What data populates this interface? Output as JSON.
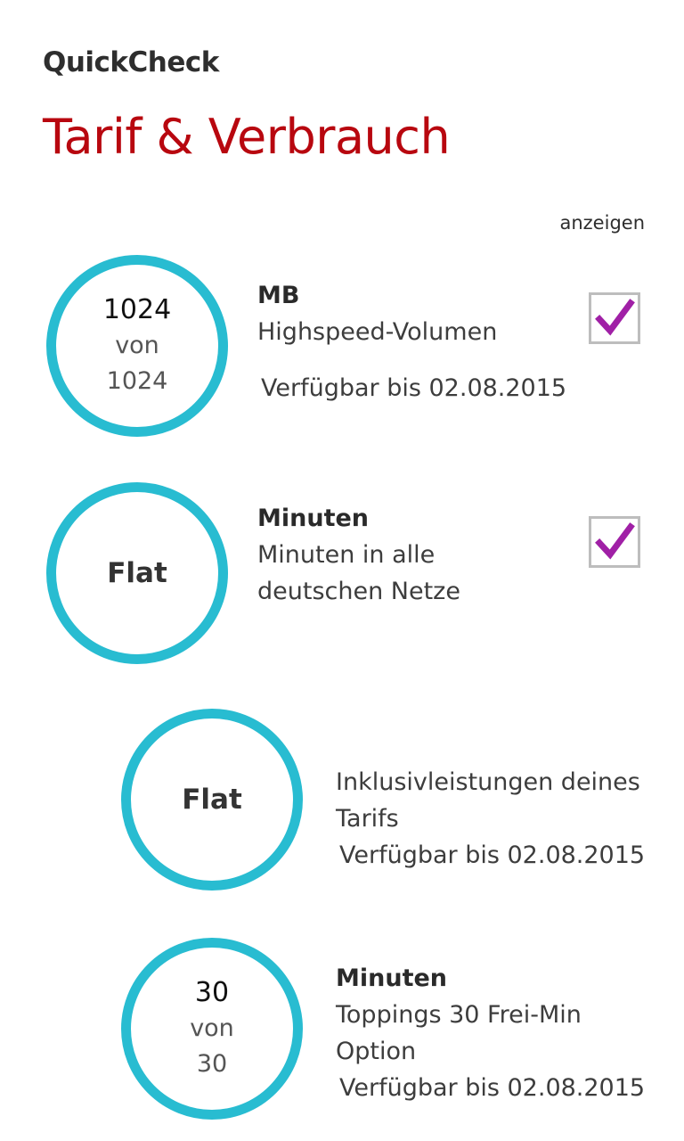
{
  "header": {
    "app_title": "QuickCheck",
    "page_title": "Tarif & Verbrauch",
    "show_label": "anzeigen"
  },
  "colors": {
    "accent_red": "#b8070f",
    "ring": "#28bcd1",
    "check": "#a020a6"
  },
  "items": [
    {
      "ring_value": "1024",
      "ring_of": "von",
      "ring_total": "1024",
      "unit": "MB",
      "description": "Highspeed-Volumen",
      "until": "Verfügbar bis 02.08.2015",
      "checked": true
    },
    {
      "ring_text": "Flat",
      "unit": "Minuten",
      "description_line1": "Minuten in alle",
      "description_line2": "deutschen Netze",
      "checked": true
    },
    {
      "ring_text": "Flat",
      "description_line1": "Inklusivleistungen deines",
      "description_line2": "Tarifs",
      "until": "Verfügbar bis 02.08.2015"
    },
    {
      "ring_value": "30",
      "ring_of": "von",
      "ring_total": "30",
      "unit": "Minuten",
      "description_line1": "Toppings 30 Frei-Min",
      "description_line2": "Option",
      "until": "Verfügbar bis 02.08.2015"
    }
  ]
}
